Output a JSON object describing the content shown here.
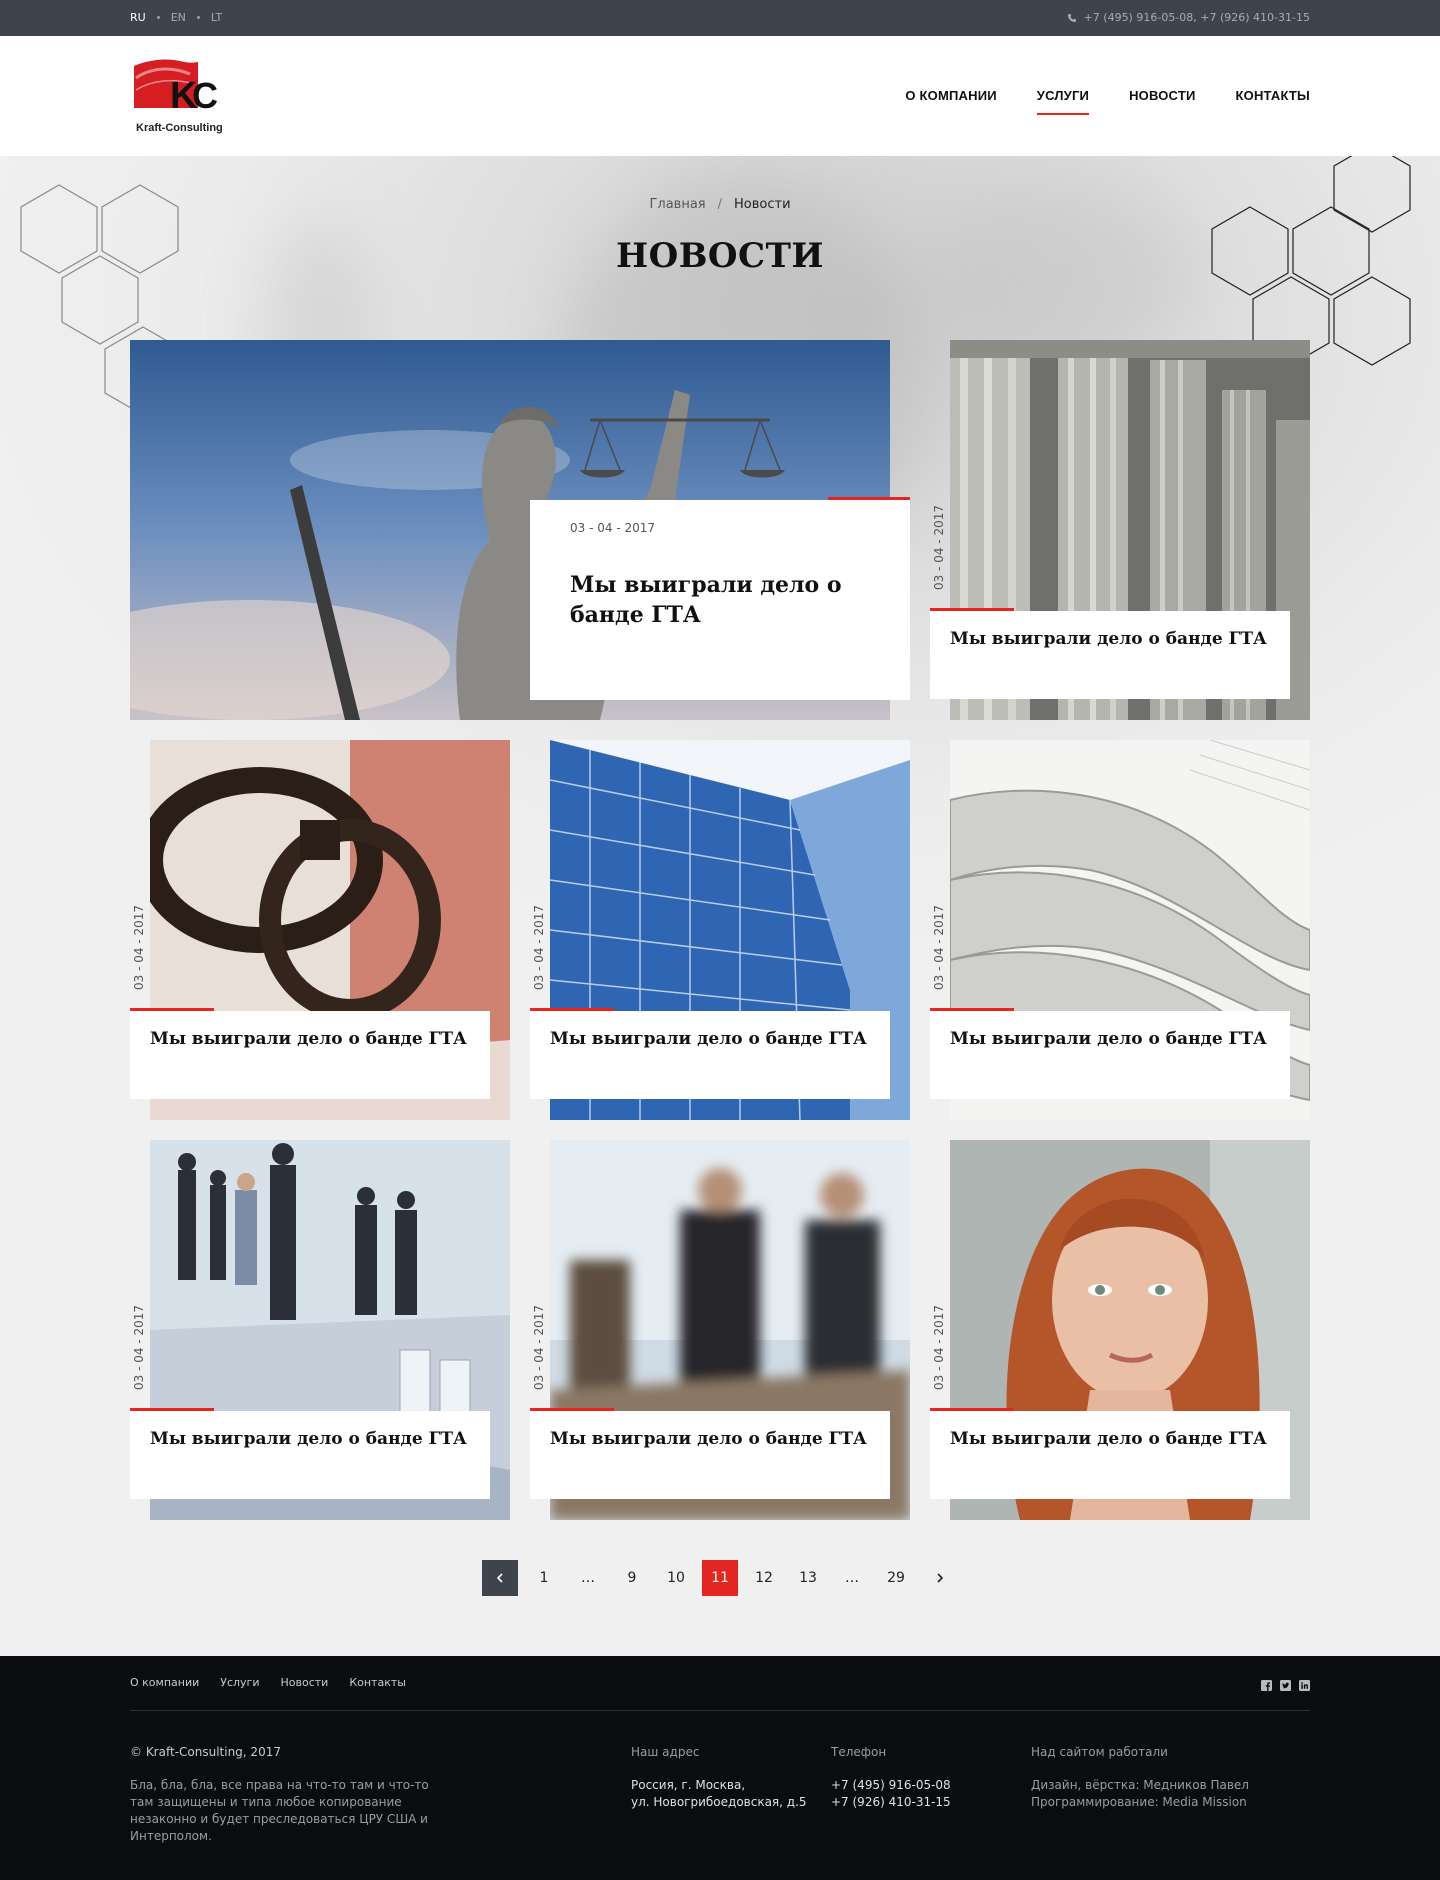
{
  "topbar": {
    "languages": [
      {
        "code": "RU",
        "active": true
      },
      {
        "code": "EN",
        "active": false
      },
      {
        "code": "LT",
        "active": false
      }
    ],
    "phones": "+7 (495) 916-05-08, +7 (926) 410-31-15",
    "phone_icon": "phone-icon"
  },
  "header": {
    "logo_text": "Kraft-Consulting",
    "logo_letters": "KC",
    "nav": [
      {
        "label": "О КОМПАНИИ",
        "active": false
      },
      {
        "label": "УСЛУГИ",
        "active": true
      },
      {
        "label": "НОВОСТИ",
        "active": false
      },
      {
        "label": "КОНТАКТЫ",
        "active": false
      }
    ]
  },
  "breadcrumb": {
    "home": "Главная",
    "separator": "/",
    "current": "Новости"
  },
  "page_title": "НОВОСТИ",
  "news": [
    {
      "date": "03 - 04 - 2017",
      "title": "Мы выиграли дело о банде ГТА",
      "image": "lady-justice-statue"
    },
    {
      "date": "03 - 04 - 2017",
      "title": "Мы выиграли дело о банде ГТА",
      "image": "columns"
    },
    {
      "date": "03 - 04 - 2017",
      "title": "Мы выиграли дело о банде ГТА",
      "image": "handcuffs"
    },
    {
      "date": "03 - 04 - 2017",
      "title": "Мы выиграли дело о банде ГТА",
      "image": "glass-building"
    },
    {
      "date": "03 - 04 - 2017",
      "title": "Мы выиграли дело о банде ГТА",
      "image": "newspapers"
    },
    {
      "date": "03 - 04 - 2017",
      "title": "Мы выиграли дело о банде ГТА",
      "image": "business-people"
    },
    {
      "date": "03 - 04 - 2017",
      "title": "Мы выиграли дело о банде ГТА",
      "image": "meeting-blurred"
    },
    {
      "date": "03 - 04 - 2017",
      "title": "Мы выиграли дело о банде ГТА",
      "image": "red-haired-woman"
    }
  ],
  "pagination": {
    "prev_icon": "chevron-left-icon",
    "next_icon": "chevron-right-icon",
    "pages": [
      "1",
      "…",
      "9",
      "10",
      "11",
      "12",
      "13",
      "…",
      "29"
    ],
    "current": "11"
  },
  "footer": {
    "nav": [
      "О компании",
      "Услуги",
      "Новости",
      "Контакты"
    ],
    "social": [
      "facebook-icon",
      "twitter-icon",
      "linkedin-icon"
    ],
    "copyright": "© Kraft-Consulting, 2017",
    "disclaimer": "Бла, бла, бла, все права на что-то там и что-то там защищены и типа любое копирование незаконно и будет преследоваться ЦРУ США и Интерполом.",
    "address_label": "Наш адрес",
    "address_line1": "Россия, г. Москва,",
    "address_line2": "ул. Новогрибоедовская, д.5",
    "phone_label": "Телефон",
    "phone1": "+7 (495) 916-05-08",
    "phone2": "+7 (926) 410-31-15",
    "credits_label": "Над сайтом работали",
    "credits_design": "Дизайн, вёрстка: Медников Павел",
    "credits_dev": "Программирование: Media Mission"
  },
  "colors": {
    "accent": "#e52520",
    "topbar": "#3f434b",
    "footer": "#0a0c10"
  }
}
